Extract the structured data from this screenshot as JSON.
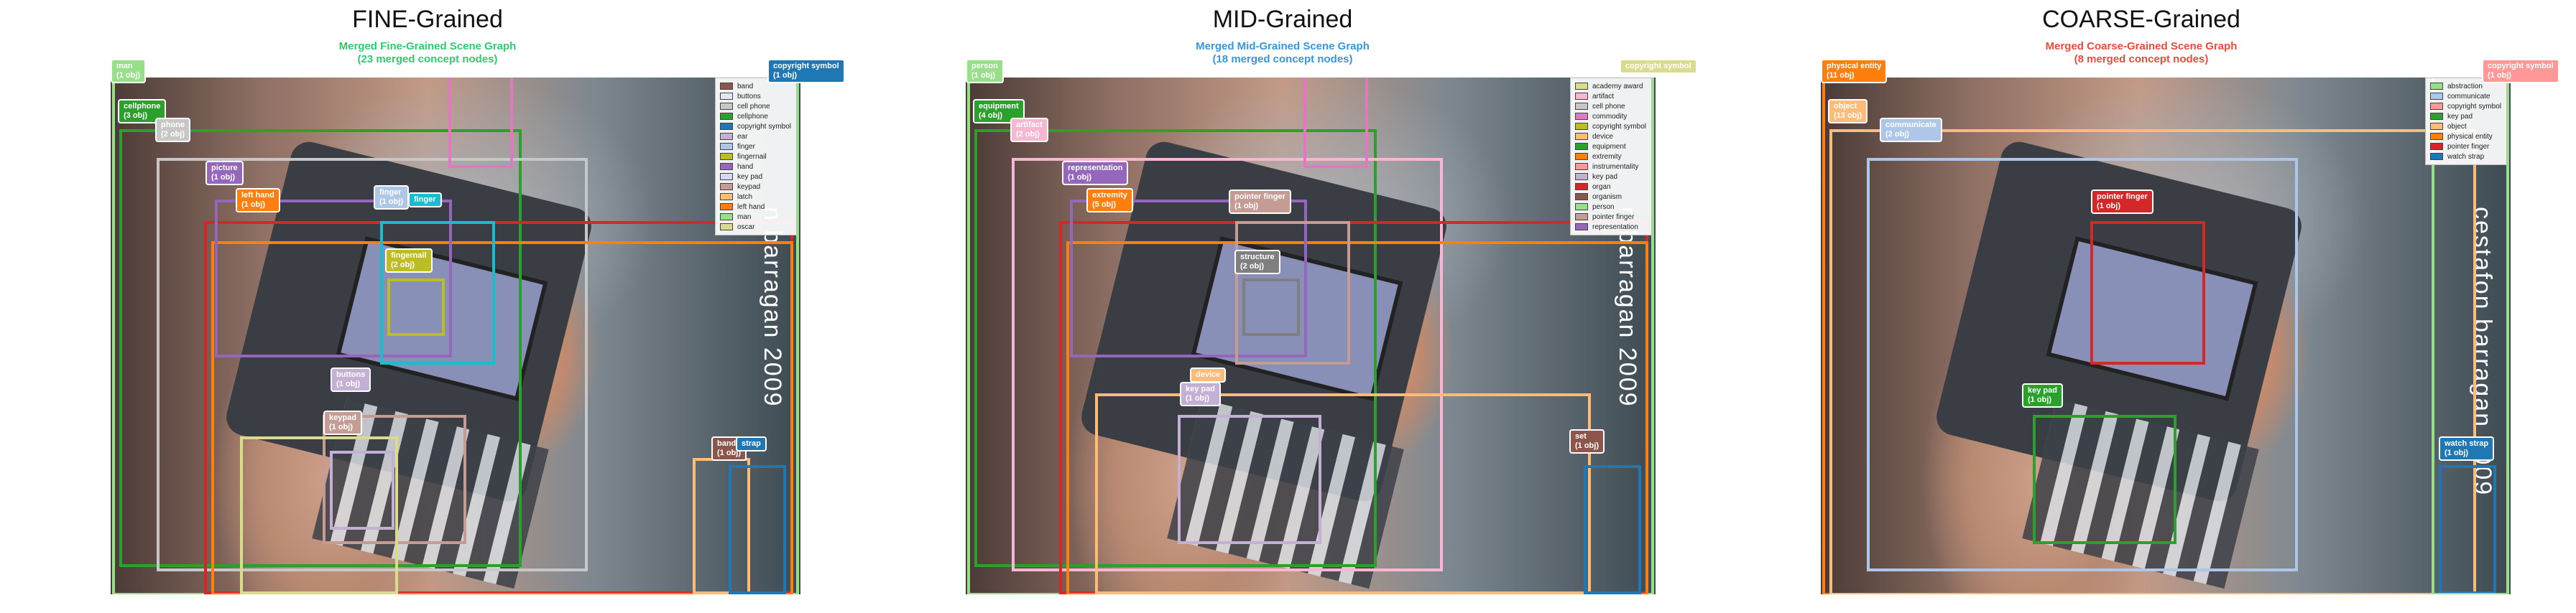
{
  "panels": [
    {
      "title": "FINE-Grained",
      "subtitle": "Merged Fine-Grained Scene Graph\n(23 merged concept nodes)",
      "subtitle_color": "#2ecc71",
      "watermark": "n barragan 2009",
      "legend": [
        {
          "label": "band",
          "color": "#8c564b"
        },
        {
          "label": "buttons",
          "color": "#e6e6fa"
        },
        {
          "label": "cell phone",
          "color": "#c7c7c7"
        },
        {
          "label": "cellphone",
          "color": "#2ca02c"
        },
        {
          "label": "copyright symbol",
          "color": "#1f77b4"
        },
        {
          "label": "ear",
          "color": "#c5b0d5"
        },
        {
          "label": "finger",
          "color": "#aec7e8"
        },
        {
          "label": "fingernail",
          "color": "#bcbd22"
        },
        {
          "label": "hand",
          "color": "#9467bd"
        },
        {
          "label": "key pad",
          "color": "#d6d6f5"
        },
        {
          "label": "keypad",
          "color": "#c49c94"
        },
        {
          "label": "latch",
          "color": "#ffbb78"
        },
        {
          "label": "left hand",
          "color": "#ff7f0e"
        },
        {
          "label": "man",
          "color": "#98df8a"
        },
        {
          "label": "oscar",
          "color": "#dbdb8d"
        }
      ],
      "tags": [
        {
          "text": "man\n(1 obj)",
          "color": "#98df8a"
        },
        {
          "text": "copyright symbol\n(1 obj)",
          "color": "#1f77b4"
        },
        {
          "text": "cellphone\n(3 obj)",
          "color": "#2ca02c"
        },
        {
          "text": "phone\n(2 obj)",
          "color": "#c7c7c7"
        },
        {
          "text": "picture\n(1 obj)",
          "color": "#9467bd"
        },
        {
          "text": "left hand\n(1 obj)",
          "color": "#ff7f0e"
        },
        {
          "text": "finger\n(1 obj)",
          "color": "#aec7e8"
        },
        {
          "text": "finger",
          "color": "#17becf"
        },
        {
          "text": "fingernail\n(2 obj)",
          "color": "#bcbd22"
        },
        {
          "text": "buttons\n(1 obj)",
          "color": "#c5b0d5"
        },
        {
          "text": "keypad\n(1 obj)",
          "color": "#c49c94"
        },
        {
          "text": "band\n(1 obj)",
          "color": "#8c564b"
        },
        {
          "text": "strap",
          "color": "#1f77b4"
        }
      ]
    },
    {
      "title": "MID-Grained",
      "subtitle": "Merged Mid-Grained Scene Graph\n(18 merged concept nodes)",
      "subtitle_color": "#3498db",
      "watermark": "n barragan 2009",
      "legend": [
        {
          "label": "academy award",
          "color": "#dbdb8d"
        },
        {
          "label": "artifact",
          "color": "#f7b6d2"
        },
        {
          "label": "cell phone",
          "color": "#c7c7c7"
        },
        {
          "label": "commodity",
          "color": "#e377c2"
        },
        {
          "label": "copyright symbol",
          "color": "#bcbd22"
        },
        {
          "label": "device",
          "color": "#ffbb78"
        },
        {
          "label": "equipment",
          "color": "#2ca02c"
        },
        {
          "label": "extremity",
          "color": "#ff7f0e"
        },
        {
          "label": "instrumentality",
          "color": "#ff9896"
        },
        {
          "label": "key pad",
          "color": "#c5b0d5"
        },
        {
          "label": "organ",
          "color": "#d62728"
        },
        {
          "label": "organism",
          "color": "#8c564b"
        },
        {
          "label": "person",
          "color": "#98df8a"
        },
        {
          "label": "pointer finger",
          "color": "#c49c94"
        },
        {
          "label": "representation",
          "color": "#9467bd"
        }
      ],
      "tags": [
        {
          "text": "person\n(1 obj)",
          "color": "#98df8a"
        },
        {
          "text": "copyright symbol",
          "color": "#dbdb8d"
        },
        {
          "text": "equipment\n(4 obj)",
          "color": "#2ca02c"
        },
        {
          "text": "artifact\n(2 obj)",
          "color": "#f7b6d2"
        },
        {
          "text": "representation\n(1 obj)",
          "color": "#9467bd"
        },
        {
          "text": "extremity\n(5 obj)",
          "color": "#ff7f0e"
        },
        {
          "text": "pointer finger\n(1 obj)",
          "color": "#c49c94"
        },
        {
          "text": "structure\n(2 obj)",
          "color": "#7f7f7f"
        },
        {
          "text": "device",
          "color": "#ffbb78"
        },
        {
          "text": "key pad\n(1 obj)",
          "color": "#c5b0d5"
        },
        {
          "text": "set\n(1 obj)",
          "color": "#8c564b"
        }
      ]
    },
    {
      "title": "COARSE-Grained",
      "subtitle": "Merged Coarse-Grained Scene Graph\n(8 merged concept nodes)",
      "subtitle_color": "#e74c3c",
      "watermark": "cestafon barragan 2009",
      "legend": [
        {
          "label": "abstraction",
          "color": "#98df8a"
        },
        {
          "label": "communicate",
          "color": "#aec7e8"
        },
        {
          "label": "copyright symbol",
          "color": "#ff9896"
        },
        {
          "label": "key pad",
          "color": "#2ca02c"
        },
        {
          "label": "object",
          "color": "#ffbb78"
        },
        {
          "label": "physical entity",
          "color": "#ff7f0e"
        },
        {
          "label": "pointer finger",
          "color": "#d62728"
        },
        {
          "label": "watch strap",
          "color": "#1f77b4"
        }
      ],
      "tags": [
        {
          "text": "physical entity\n(11 obj)",
          "color": "#ff7f0e"
        },
        {
          "text": "copyright symbol\n(1 obj)",
          "color": "#ff9896"
        },
        {
          "text": "object\n(13 obj)",
          "color": "#ffbb78"
        },
        {
          "text": "communicate\n(2 obj)",
          "color": "#aec7e8"
        },
        {
          "text": "pointer finger\n(1 obj)",
          "color": "#d62728"
        },
        {
          "text": "key pad\n(1 obj)",
          "color": "#2ca02c"
        },
        {
          "text": "watch strap\n(1 obj)",
          "color": "#1f77b4"
        }
      ]
    }
  ]
}
